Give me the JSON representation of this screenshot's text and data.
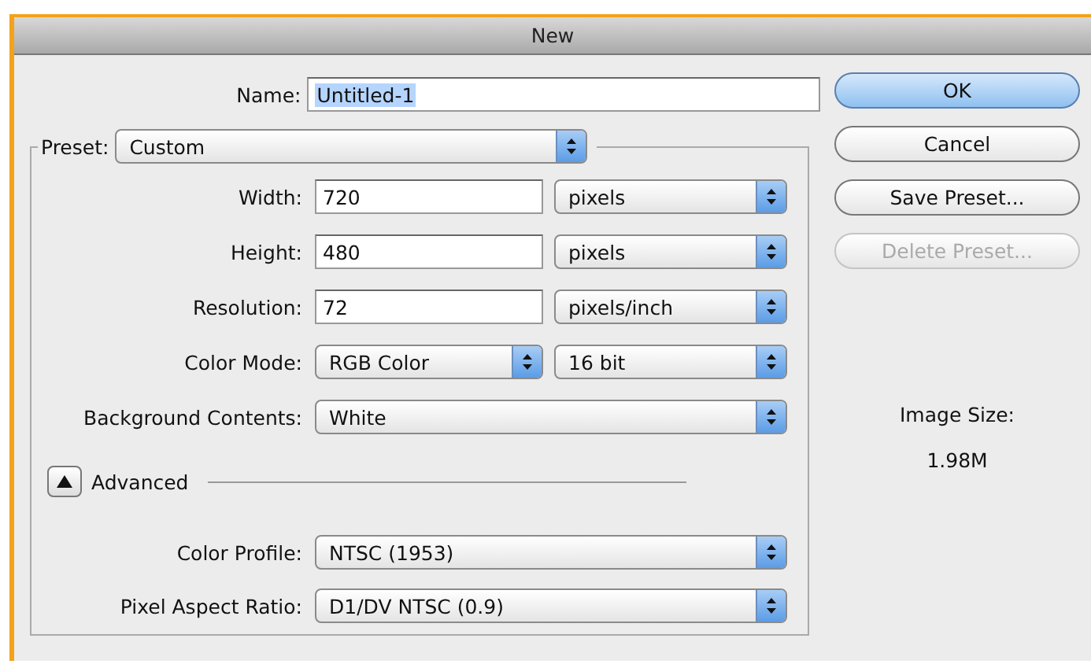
{
  "window": {
    "title": "New"
  },
  "name": {
    "label": "Name:",
    "value": "Untitled-1",
    "highlighted": true
  },
  "preset": {
    "label": "Preset:",
    "value": "Custom"
  },
  "fields": [
    {
      "kind": "number_unit",
      "label": "Width:",
      "value": "720",
      "unit": "pixels"
    },
    {
      "kind": "number_unit",
      "label": "Height:",
      "value": "480",
      "unit": "pixels"
    },
    {
      "kind": "number_unit",
      "label": "Resolution:",
      "value": "72",
      "unit": "pixels/inch"
    },
    {
      "kind": "popup_pair",
      "label": "Color Mode:",
      "value": "RGB Color",
      "unit": "16 bit"
    },
    {
      "kind": "popup",
      "label": "Background Contents:",
      "value": "White"
    }
  ],
  "advanced": {
    "label": "Advanced",
    "expanded": true
  },
  "advanced_fields": [
    {
      "label": "Color Profile:",
      "value": "NTSC (1953)"
    },
    {
      "label": "Pixel Aspect Ratio:",
      "value": "D1/DV NTSC (0.9)"
    }
  ],
  "buttons": [
    {
      "label": "OK",
      "default": true,
      "disabled": false
    },
    {
      "label": "Cancel",
      "default": false,
      "disabled": false
    },
    {
      "label": "Save Preset...",
      "default": false,
      "disabled": false
    },
    {
      "label": "Delete Preset...",
      "default": false,
      "disabled": true
    }
  ],
  "image_size": {
    "label": "Image Size:",
    "value": "1.98M"
  }
}
